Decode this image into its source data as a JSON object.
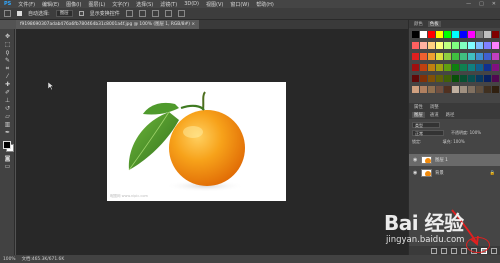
{
  "menu": {
    "items": [
      "PS",
      "文件(F)",
      "编辑(E)",
      "图像(I)",
      "图层(L)",
      "文字(Y)",
      "选择(S)",
      "滤镜(T)",
      "3D(D)",
      "视图(V)",
      "窗口(W)",
      "帮助(H)"
    ],
    "window_controls": [
      "—",
      "□",
      "✕"
    ]
  },
  "options": {
    "auto_select_label": "自动选择:",
    "auto_select_value": "图层",
    "show_transform_label": "显示变换控件"
  },
  "document_tab": {
    "title": "f9198690307adab476a6fb780464b31c8001a4f.jpg @ 100% (图层 1, RGB/8#) ×"
  },
  "status": {
    "zoom": "100%",
    "doc_info": "文档:465.3K/671.6K"
  },
  "swatches_panel": {
    "tabs": [
      "颜色",
      "色板"
    ],
    "colors": [
      [
        "#000000",
        "#ffffff",
        "#ff0000",
        "#ffff00",
        "#00ff00",
        "#00ffff",
        "#0000ff",
        "#ff00ff",
        "#808080",
        "#c0c0c0",
        "#800000"
      ],
      [
        "#ff6060",
        "#ffb0a0",
        "#ffd080",
        "#ffff80",
        "#c0ff80",
        "#80ff80",
        "#80ffc0",
        "#80ffff",
        "#80c0ff",
        "#8080ff",
        "#ff80ff"
      ],
      [
        "#e02020",
        "#f06030",
        "#f0a030",
        "#e0e040",
        "#90d040",
        "#40c040",
        "#40c080",
        "#40c0c0",
        "#4090d0",
        "#4060d0",
        "#c040c0"
      ],
      [
        "#a01010",
        "#c04010",
        "#c08010",
        "#a0a010",
        "#60a010",
        "#108010",
        "#108050",
        "#108080",
        "#106090",
        "#103090",
        "#801080"
      ],
      [
        "#600808",
        "#803008",
        "#805008",
        "#606008",
        "#406008",
        "#085008",
        "#085030",
        "#085050",
        "#083860",
        "#082060",
        "#500850"
      ],
      [
        "#d0a080",
        "#b08060",
        "#907050",
        "#705040",
        "#503020",
        "#c0b0a0",
        "#a09080",
        "#807060",
        "#605040",
        "#403020",
        "#302010"
      ]
    ]
  },
  "mid_panel": {
    "tabs": [
      "属性",
      "调整"
    ]
  },
  "layers_panel": {
    "tabs": [
      "图层",
      "通道",
      "路径"
    ],
    "filter_label": "类型",
    "blend_mode": "正常",
    "opacity_label": "不透明度: 100%",
    "lock_label": "锁定:",
    "fill_label": "填充: 100%",
    "layers": [
      {
        "name": "图层 1",
        "selected": true
      },
      {
        "name": "背景",
        "selected": false
      }
    ]
  },
  "watermark": {
    "logo": "Bai 经验",
    "url": "jingyan.baidu.com"
  },
  "document": {
    "bottom_text": "昵图网 www.nipic.com"
  }
}
